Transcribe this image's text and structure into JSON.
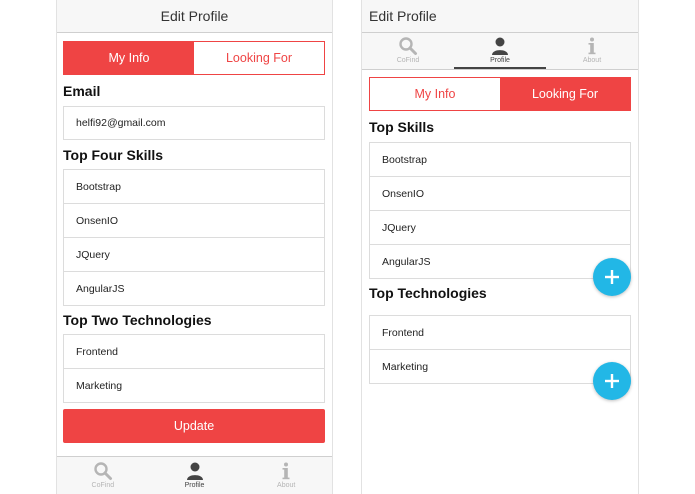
{
  "left": {
    "title": "Edit Profile",
    "segment": {
      "active": "My Info",
      "inactive": "Looking For"
    },
    "email_label": "Email",
    "email_value": "helfi92@gmail.com",
    "skills_label": "Top Four Skills",
    "skills": [
      "Bootstrap",
      "OnsenIO",
      "JQuery",
      "AngularJS"
    ],
    "tech_label": "Top Two Technologies",
    "technologies": [
      "Frontend",
      "Marketing"
    ],
    "update_label": "Update",
    "tabs": [
      {
        "label": "CoFind",
        "icon": "search-icon"
      },
      {
        "label": "Profile",
        "icon": "person-icon"
      },
      {
        "label": "About",
        "icon": "info-icon"
      }
    ]
  },
  "right": {
    "title": "Edit Profile",
    "tabs": [
      {
        "label": "CoFind",
        "icon": "search-icon"
      },
      {
        "label": "Profile",
        "icon": "person-icon"
      },
      {
        "label": "About",
        "icon": "info-icon"
      }
    ],
    "segment": {
      "inactive": "My Info",
      "active": "Looking For"
    },
    "skills_label": "Top Skills",
    "skills": [
      "Bootstrap",
      "OnsenIO",
      "JQuery",
      "AngularJS"
    ],
    "tech_label": "Top Technologies",
    "technologies": [
      "Frontend",
      "Marketing"
    ]
  },
  "colors": {
    "accent": "#ef4444",
    "fab": "#22b7e6"
  }
}
